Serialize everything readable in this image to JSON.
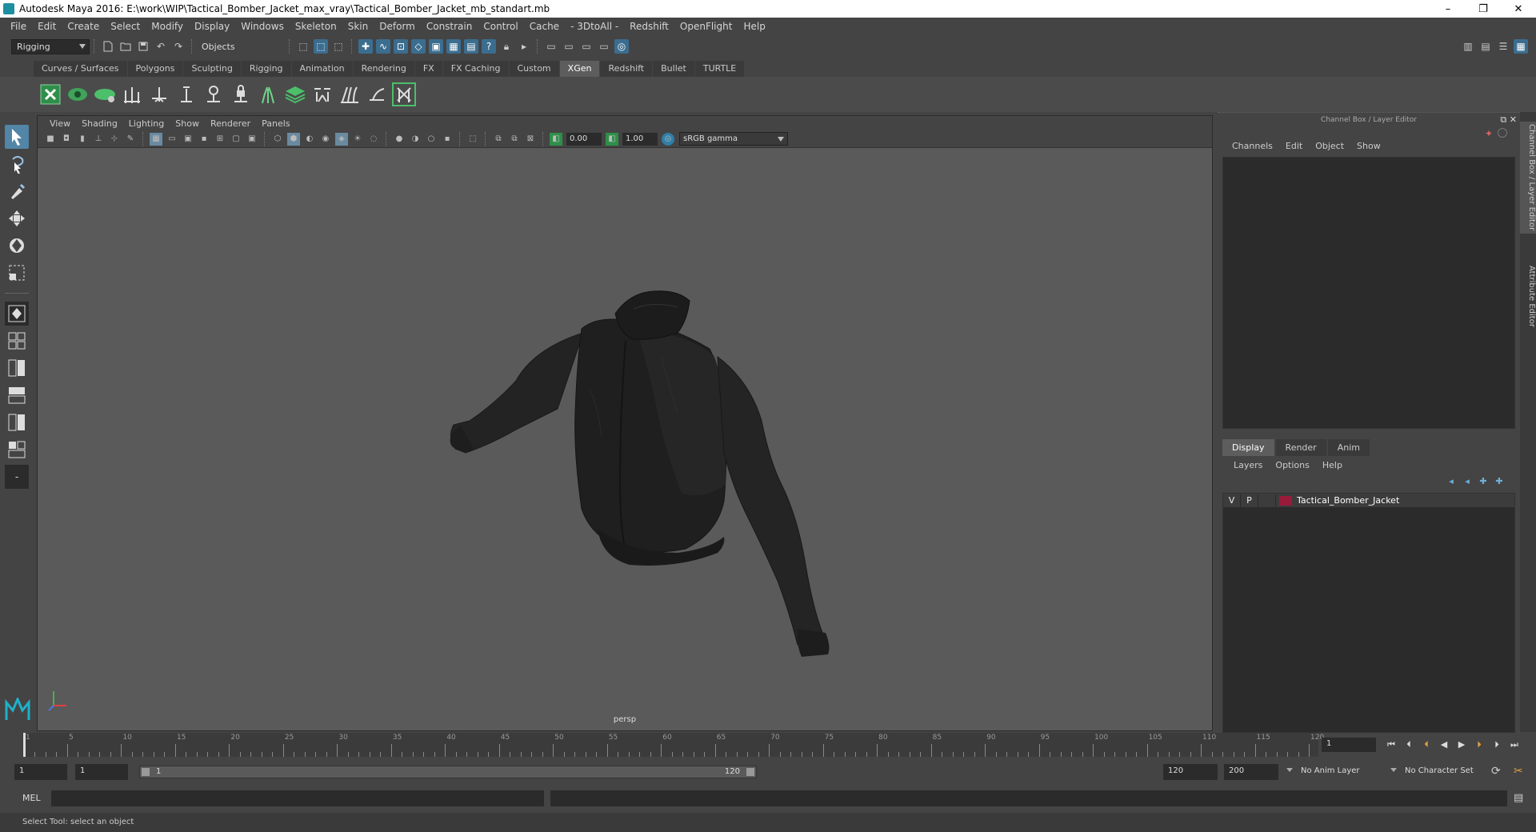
{
  "window": {
    "title": "Autodesk Maya 2016: E:\\work\\WIP\\Tactical_Bomber_Jacket_max_vray\\Tactical_Bomber_Jacket_mb_standart.mb",
    "minimize": "–",
    "restore": "❐",
    "close": "✕"
  },
  "menubar": [
    "File",
    "Edit",
    "Create",
    "Select",
    "Modify",
    "Display",
    "Windows",
    "Skeleton",
    "Skin",
    "Deform",
    "Constrain",
    "Control",
    "Cache",
    "- 3DtoAll -",
    "Redshift",
    "OpenFlight",
    "Help"
  ],
  "statusline": {
    "menuset": "Rigging",
    "selection_mode": "Objects"
  },
  "shelf": {
    "tabs": [
      "Curves / Surfaces",
      "Polygons",
      "Sculpting",
      "Rigging",
      "Animation",
      "Rendering",
      "FX",
      "FX Caching",
      "Custom",
      "XGen",
      "Redshift",
      "Bullet",
      "TURTLE"
    ],
    "active_tab": "XGen"
  },
  "viewport": {
    "menu": [
      "View",
      "Shading",
      "Lighting",
      "Show",
      "Renderer",
      "Panels"
    ],
    "exposure": "0.00",
    "gamma": "1.00",
    "color_space": "sRGB gamma",
    "camera": "persp"
  },
  "channelbox": {
    "title": "Channel Box / Layer Editor",
    "menu": [
      "Channels",
      "Edit",
      "Object",
      "Show"
    ]
  },
  "layer_editor": {
    "tabs": [
      "Display",
      "Render",
      "Anim"
    ],
    "active_tab": "Display",
    "menu": [
      "Layers",
      "Options",
      "Help"
    ],
    "layers": [
      {
        "visible": "V",
        "playback": "P",
        "name": "Tactical_Bomber_Jacket",
        "color": "#9a1a3a"
      }
    ]
  },
  "side_tabs": [
    "Channel Box / Layer Editor",
    "Attribute Editor"
  ],
  "timeslider": {
    "ticks": [
      1,
      5,
      10,
      15,
      20,
      25,
      30,
      35,
      40,
      45,
      50,
      55,
      60,
      65,
      70,
      75,
      80,
      85,
      90,
      95,
      100,
      105,
      110,
      115,
      120
    ],
    "current_frame": "1"
  },
  "range": {
    "start": "1",
    "playback_start": "1",
    "range_start_label": "1",
    "range_end_label": "120",
    "playback_end": "120",
    "end": "200",
    "anim_layer": "No Anim Layer",
    "character_set": "No Character Set"
  },
  "cmdline": {
    "lang": "MEL"
  },
  "helpline": {
    "text": "Select Tool: select an object"
  }
}
